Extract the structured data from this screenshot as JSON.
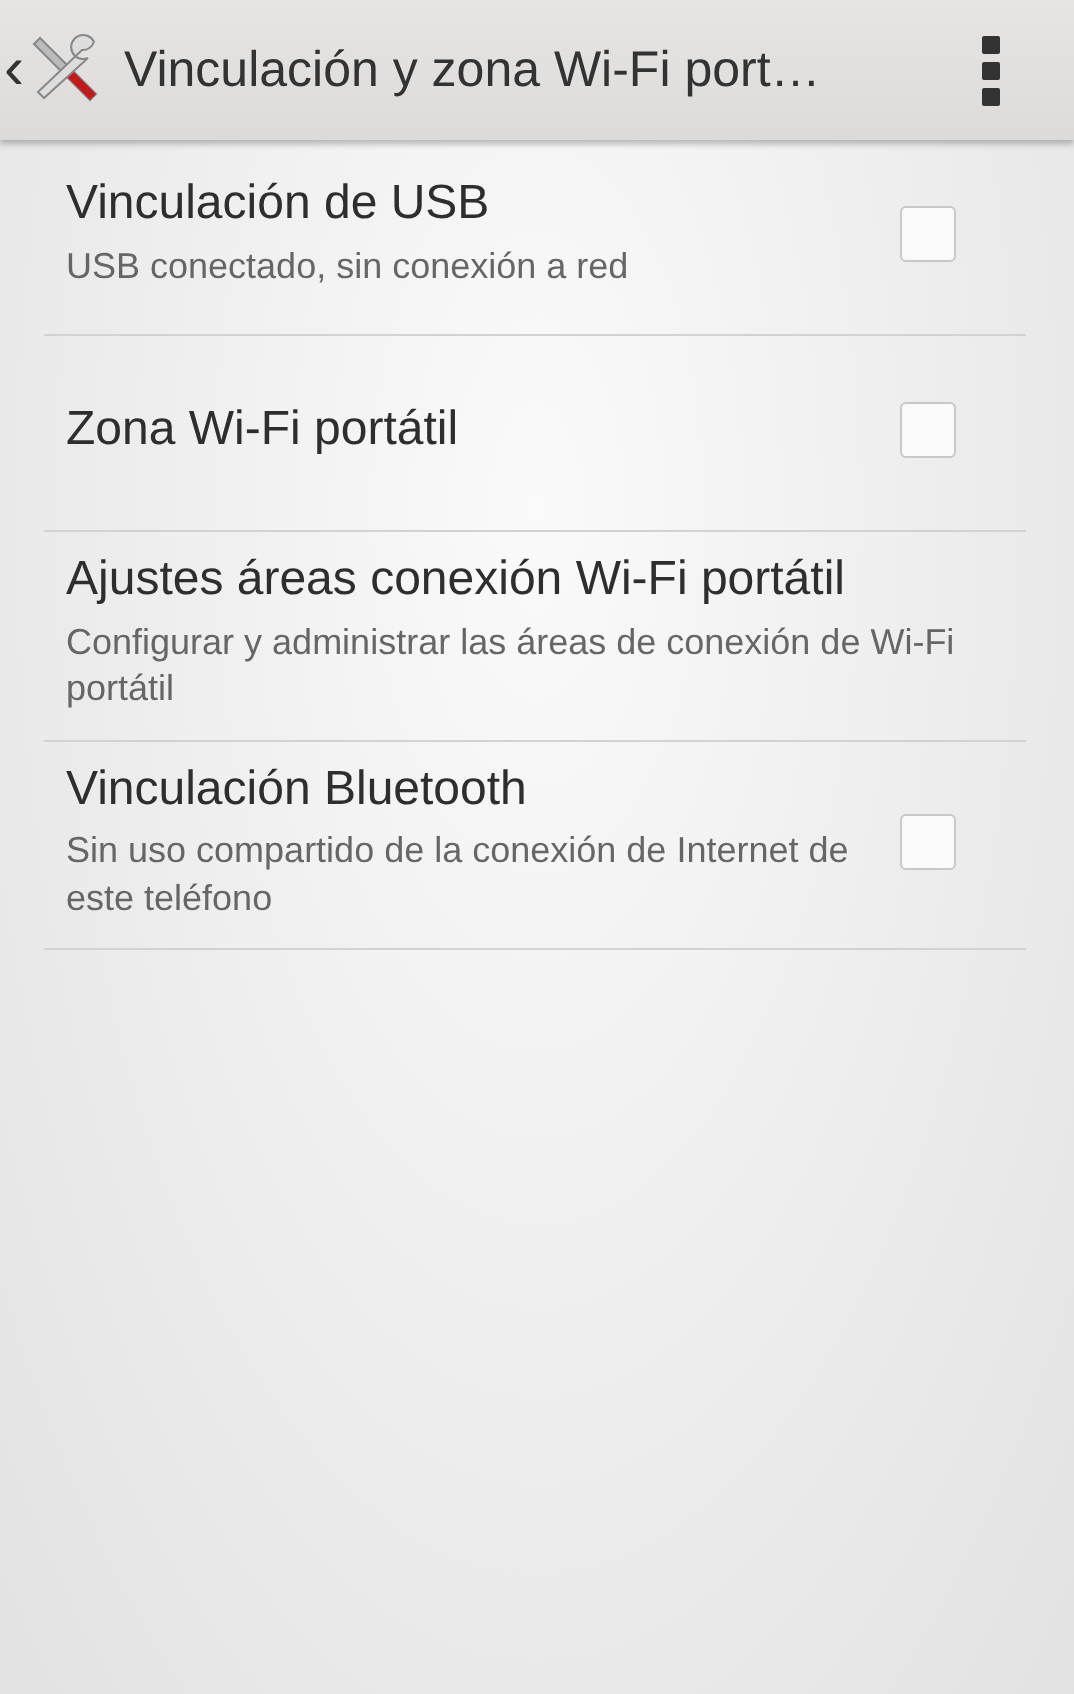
{
  "action_bar": {
    "back": "‹",
    "title": "Vinculación y zona Wi-Fi port…"
  },
  "items": [
    {
      "kind": "checkbox",
      "title": "Vinculación de USB",
      "summary": "USB conectado, sin conexión a red",
      "checked": false
    },
    {
      "kind": "checkbox",
      "title": "Zona Wi-Fi portátil",
      "checked": false
    },
    {
      "kind": "link",
      "title": "Ajustes áreas conexión Wi-Fi portátil",
      "summary": "Configurar y administrar las áreas de conexión de Wi-Fi portátil"
    },
    {
      "kind": "checkbox",
      "title": "Vinculación Bluetooth",
      "summary": "Sin uso compartido de la conexión de Internet de este teléfono",
      "checked": false
    }
  ]
}
